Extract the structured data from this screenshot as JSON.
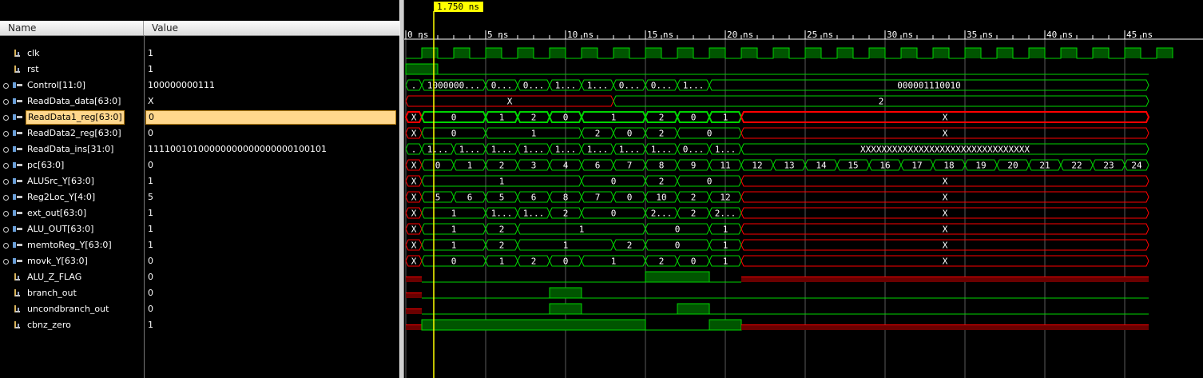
{
  "header": {
    "name_label": "Name",
    "value_label": "Value"
  },
  "cursor": {
    "label": "1.750 ns",
    "time": 1.75
  },
  "timeline": {
    "start_ns": 0,
    "end_ns": 46.5,
    "tick_step_ns": 5,
    "tick_labels": [
      "0 ns",
      "5 ns",
      "10 ns",
      "15 ns",
      "20 ns",
      "25 ns",
      "30 ns",
      "35 ns",
      "40 ns",
      "45 ns"
    ]
  },
  "colors": {
    "wave": "#00d400",
    "wave_fill": "#005500",
    "x_line": "#ff0000",
    "x_fill": "#6a0000",
    "cursor": "#ffff00",
    "grid": "#5a5a5a"
  },
  "signals": [
    {
      "name": "clk",
      "value": "1",
      "kind": "bit",
      "icon": "wire-icon",
      "clk": true
    },
    {
      "name": "rst",
      "value": "1",
      "kind": "bit",
      "icon": "wire-icon",
      "segs": [
        [
          0,
          2,
          "1"
        ],
        [
          2,
          46.5,
          "0"
        ]
      ]
    },
    {
      "name": "Control[11:0]",
      "value": "100000000111",
      "kind": "bus",
      "icon": "bus-icon",
      "segs": [
        [
          0,
          1,
          "."
        ],
        [
          1,
          5,
          "1000000..."
        ],
        [
          5,
          7,
          "0..."
        ],
        [
          7,
          9,
          "0..."
        ],
        [
          9,
          11,
          "1..."
        ],
        [
          11,
          13,
          "1..."
        ],
        [
          13,
          15,
          "0..."
        ],
        [
          15,
          17,
          "0..."
        ],
        [
          17,
          19,
          "1..."
        ],
        [
          19,
          46.5,
          "000001110010"
        ]
      ]
    },
    {
      "name": "ReadData_data[63:0]",
      "value": "X",
      "kind": "bus",
      "icon": "bus-icon",
      "segs": [
        [
          0,
          13,
          "X",
          "x"
        ],
        [
          13,
          46.5,
          "2"
        ]
      ]
    },
    {
      "name": "ReadData1_reg[63:0]",
      "value": "0",
      "kind": "bus",
      "icon": "bus-icon",
      "selected": true,
      "segs": [
        [
          0,
          1,
          "X",
          "x"
        ],
        [
          1,
          5,
          "0"
        ],
        [
          5,
          7,
          "1"
        ],
        [
          7,
          9,
          "2"
        ],
        [
          9,
          11,
          "0"
        ],
        [
          11,
          15,
          "1"
        ],
        [
          15,
          17,
          "2"
        ],
        [
          17,
          19,
          "0"
        ],
        [
          19,
          21,
          "1"
        ],
        [
          21,
          46.5,
          "X",
          "x"
        ]
      ]
    },
    {
      "name": "ReadData2_reg[63:0]",
      "value": "0",
      "kind": "bus",
      "icon": "bus-icon",
      "segs": [
        [
          0,
          1,
          "X",
          "x"
        ],
        [
          1,
          5,
          "0"
        ],
        [
          5,
          11,
          "1"
        ],
        [
          11,
          13,
          "2"
        ],
        [
          13,
          15,
          "0"
        ],
        [
          15,
          17,
          "2"
        ],
        [
          17,
          21,
          "0"
        ],
        [
          21,
          46.5,
          "X",
          "x"
        ]
      ]
    },
    {
      "name": "ReadData_ins[31:0]",
      "value": "11110010100000000000000000100101",
      "kind": "bus",
      "icon": "bus-icon",
      "segs": [
        [
          0,
          1,
          "."
        ],
        [
          1,
          3,
          "1..."
        ],
        [
          3,
          5,
          "1..."
        ],
        [
          5,
          7,
          "1..."
        ],
        [
          7,
          9,
          "1..."
        ],
        [
          9,
          11,
          "1..."
        ],
        [
          11,
          13,
          "1..."
        ],
        [
          13,
          15,
          "1..."
        ],
        [
          15,
          17,
          "1..."
        ],
        [
          17,
          19,
          "0..."
        ],
        [
          19,
          21,
          "1..."
        ],
        [
          21,
          46.5,
          "XXXXXXXXXXXXXXXXXXXXXXXXXXXXXXXX"
        ]
      ]
    },
    {
      "name": "pc[63:0]",
      "value": "0",
      "kind": "bus",
      "icon": "bus-icon",
      "segs": [
        [
          0,
          1,
          "X",
          "x"
        ],
        [
          1,
          3,
          "0"
        ],
        [
          3,
          5,
          "1"
        ],
        [
          5,
          7,
          "2"
        ],
        [
          7,
          9,
          "3"
        ],
        [
          9,
          11,
          "4"
        ],
        [
          11,
          13,
          "6"
        ],
        [
          13,
          15,
          "7"
        ],
        [
          15,
          17,
          "8"
        ],
        [
          17,
          19,
          "9"
        ],
        [
          19,
          21,
          "11"
        ],
        [
          21,
          23,
          "12"
        ],
        [
          23,
          25,
          "13"
        ],
        [
          25,
          27,
          "14"
        ],
        [
          27,
          29,
          "15"
        ],
        [
          29,
          31,
          "16"
        ],
        [
          31,
          33,
          "17"
        ],
        [
          33,
          35,
          "18"
        ],
        [
          35,
          37,
          "19"
        ],
        [
          37,
          39,
          "20"
        ],
        [
          39,
          41,
          "21"
        ],
        [
          41,
          43,
          "22"
        ],
        [
          43,
          45,
          "23"
        ],
        [
          45,
          46.5,
          "24"
        ]
      ]
    },
    {
      "name": "ALUSrc_Y[63:0]",
      "value": "1",
      "kind": "bus",
      "icon": "bus-icon",
      "segs": [
        [
          0,
          1,
          "X",
          "x"
        ],
        [
          1,
          11,
          "1"
        ],
        [
          11,
          15,
          "0"
        ],
        [
          15,
          17,
          "2"
        ],
        [
          17,
          21,
          "0"
        ],
        [
          21,
          46.5,
          "X",
          "x"
        ]
      ]
    },
    {
      "name": "Reg2Loc_Y[4:0]",
      "value": "5",
      "kind": "bus",
      "icon": "bus-icon",
      "segs": [
        [
          0,
          1,
          "X",
          "x"
        ],
        [
          1,
          3,
          "5"
        ],
        [
          3,
          5,
          "6"
        ],
        [
          5,
          7,
          "5"
        ],
        [
          7,
          9,
          "6"
        ],
        [
          9,
          11,
          "8"
        ],
        [
          11,
          13,
          "7"
        ],
        [
          13,
          15,
          "0"
        ],
        [
          15,
          17,
          "10"
        ],
        [
          17,
          19,
          "2"
        ],
        [
          19,
          21,
          "12"
        ],
        [
          21,
          46.5,
          "X",
          "x"
        ]
      ]
    },
    {
      "name": "ext_out[63:0]",
      "value": "1",
      "kind": "bus",
      "icon": "bus-icon",
      "segs": [
        [
          0,
          1,
          "X",
          "x"
        ],
        [
          1,
          5,
          "1"
        ],
        [
          5,
          7,
          "1..."
        ],
        [
          7,
          9,
          "1..."
        ],
        [
          9,
          11,
          "2"
        ],
        [
          11,
          15,
          "0"
        ],
        [
          15,
          17,
          "2..."
        ],
        [
          17,
          19,
          "2"
        ],
        [
          19,
          21,
          "2..."
        ],
        [
          21,
          46.5,
          "X",
          "x"
        ]
      ]
    },
    {
      "name": "ALU_OUT[63:0]",
      "value": "1",
      "kind": "bus",
      "icon": "bus-icon",
      "segs": [
        [
          0,
          1,
          "X",
          "x"
        ],
        [
          1,
          5,
          "1"
        ],
        [
          5,
          7,
          "2"
        ],
        [
          7,
          15,
          "1"
        ],
        [
          15,
          19,
          "0"
        ],
        [
          19,
          21,
          "1"
        ],
        [
          21,
          46.5,
          "X",
          "x"
        ]
      ]
    },
    {
      "name": "memtoReg_Y[63:0]",
      "value": "1",
      "kind": "bus",
      "icon": "bus-icon",
      "segs": [
        [
          0,
          1,
          "X",
          "x"
        ],
        [
          1,
          5,
          "1"
        ],
        [
          5,
          7,
          "2"
        ],
        [
          7,
          13,
          "1"
        ],
        [
          13,
          15,
          "2"
        ],
        [
          15,
          19,
          "0"
        ],
        [
          19,
          21,
          "1"
        ],
        [
          21,
          46.5,
          "X",
          "x"
        ]
      ]
    },
    {
      "name": "movk_Y[63:0]",
      "value": "0",
      "kind": "bus",
      "icon": "bus-icon",
      "segs": [
        [
          0,
          1,
          "X",
          "x"
        ],
        [
          1,
          5,
          "0"
        ],
        [
          5,
          7,
          "1"
        ],
        [
          7,
          9,
          "2"
        ],
        [
          9,
          11,
          "0"
        ],
        [
          11,
          15,
          "1"
        ],
        [
          15,
          17,
          "2"
        ],
        [
          17,
          19,
          "0"
        ],
        [
          19,
          21,
          "1"
        ],
        [
          21,
          46.5,
          "X",
          "x"
        ]
      ]
    },
    {
      "name": "ALU_Z_FLAG",
      "value": "0",
      "kind": "bit",
      "icon": "wire-icon",
      "segs": [
        [
          0,
          1,
          "X",
          "x"
        ],
        [
          1,
          15,
          "0"
        ],
        [
          15,
          19,
          "1"
        ],
        [
          19,
          21,
          "0"
        ],
        [
          21,
          46.5,
          "X",
          "x"
        ]
      ]
    },
    {
      "name": "branch_out",
      "value": "0",
      "kind": "bit",
      "icon": "wire-icon",
      "segs": [
        [
          0,
          1,
          "X",
          "x"
        ],
        [
          1,
          9,
          "0"
        ],
        [
          9,
          11,
          "1"
        ],
        [
          11,
          46.5,
          "0"
        ]
      ]
    },
    {
      "name": "uncondbranch_out",
      "value": "0",
      "kind": "bit",
      "icon": "wire-icon",
      "segs": [
        [
          0,
          1,
          "X",
          "x"
        ],
        [
          1,
          9,
          "0"
        ],
        [
          9,
          11,
          "1"
        ],
        [
          11,
          17,
          "0"
        ],
        [
          17,
          19,
          "1"
        ],
        [
          19,
          46.5,
          "0"
        ]
      ]
    },
    {
      "name": "cbnz_zero",
      "value": "1",
      "kind": "bit",
      "icon": "wire-icon",
      "segs": [
        [
          0,
          1,
          "X",
          "x"
        ],
        [
          1,
          15,
          "1"
        ],
        [
          15,
          19,
          "0"
        ],
        [
          19,
          21,
          "1"
        ],
        [
          21,
          46.5,
          "X",
          "x"
        ]
      ]
    }
  ]
}
